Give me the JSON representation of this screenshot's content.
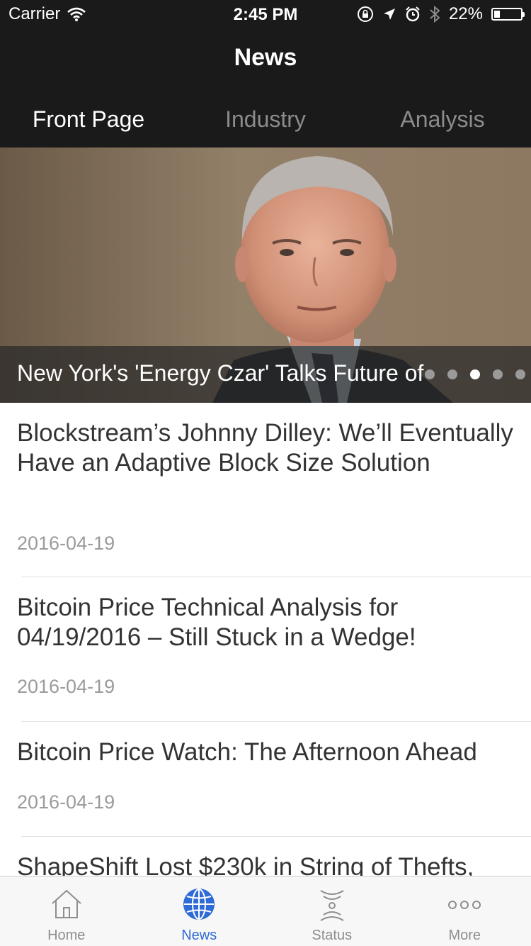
{
  "status_bar": {
    "carrier": "Carrier",
    "time": "2:45 PM",
    "battery": "22%",
    "battery_level": 0.22
  },
  "nav": {
    "title": "News"
  },
  "tabs": [
    {
      "label": "Front Page",
      "active": true
    },
    {
      "label": "Industry",
      "active": false
    },
    {
      "label": "Analysis",
      "active": false
    }
  ],
  "hero": {
    "caption": "New York's 'Energy Czar' Talks Future of Blockchain",
    "dots": 5,
    "active_dot": 2
  },
  "articles": [
    {
      "headline": "Blockstream’s Johnny Dilley: We’ll Eventually Have an Adaptive Block Size Solution",
      "date": "2016-04-19"
    },
    {
      "headline": "Bitcoin Price Technical Analysis for 04/19/2016 – Still Stuck in a Wedge!",
      "date": "2016-04-19"
    },
    {
      "headline": "Bitcoin Price Watch: The Afternoon Ahead",
      "date": "2016-04-19"
    },
    {
      "headline": "ShapeShift Lost $230k in String of Thefts,",
      "date": ""
    }
  ],
  "tab_bar": [
    {
      "label": "Home",
      "icon": "house-icon",
      "active": false
    },
    {
      "label": "News",
      "icon": "globe-icon",
      "active": true
    },
    {
      "label": "Status",
      "icon": "status-icon",
      "active": false
    },
    {
      "label": "More",
      "icon": "more-dots-icon",
      "active": false
    }
  ],
  "colors": {
    "bar_dark": "#1a1a1a",
    "accent": "#2f6bd6",
    "headline": "#333333",
    "date": "#9b9b9b"
  }
}
